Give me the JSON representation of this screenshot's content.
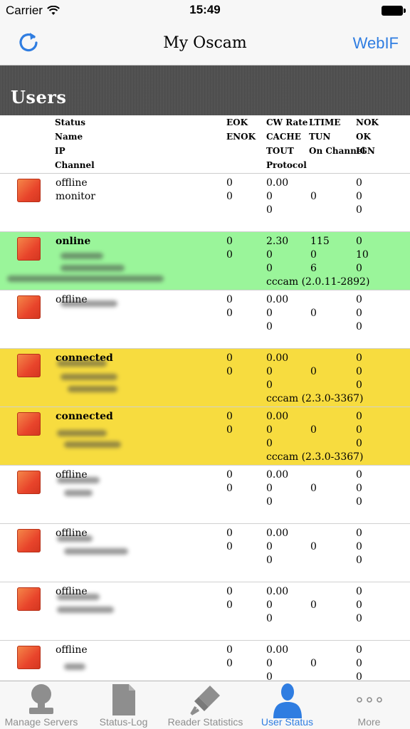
{
  "status_bar": {
    "carrier": "Carrier",
    "time": "15:49"
  },
  "nav": {
    "title": "My Oscam",
    "right_button": "WebIF"
  },
  "section": {
    "title": "Users"
  },
  "headers": {
    "c1": [
      "Status",
      "Name",
      "IP",
      "Channel"
    ],
    "c2": [
      "EOK",
      "ENOK"
    ],
    "c3": [
      "CW Rate",
      "CACHE",
      "TOUT",
      "Protocol"
    ],
    "c4": [
      "LTIME",
      "TUN",
      "On Channel"
    ],
    "c5": [
      "NOK",
      "OK",
      "IGN"
    ]
  },
  "rows": [
    {
      "status": "offline",
      "name": "monitor",
      "bg": "#ffffff",
      "bold": false,
      "eok": "0",
      "enok": "0",
      "cw": "0.00",
      "cache": "0",
      "tout": "0",
      "protocol": "",
      "ltime": "",
      "tun": "0",
      "onch": "",
      "nok": "0",
      "ok": "0",
      "ign": "0"
    },
    {
      "status": "online",
      "name": "",
      "bg": "#9af59a",
      "bold": true,
      "eok": "0",
      "enok": "0",
      "cw": "2.30",
      "cache": "0",
      "tout": "0",
      "protocol": "cccam (2.0.11-2892)",
      "ltime": "115",
      "tun": "0",
      "onch": "6",
      "nok": "0",
      "ok": "10",
      "ign": "0"
    },
    {
      "status": "offline",
      "name": "",
      "bg": "#ffffff",
      "bold": false,
      "eok": "0",
      "enok": "0",
      "cw": "0.00",
      "cache": "0",
      "tout": "0",
      "protocol": "",
      "ltime": "",
      "tun": "0",
      "onch": "",
      "nok": "0",
      "ok": "0",
      "ign": "0"
    },
    {
      "status": "connected",
      "name": "",
      "bg": "#f7dc3f",
      "bold": true,
      "eok": "0",
      "enok": "0",
      "cw": "0.00",
      "cache": "0",
      "tout": "0",
      "protocol": "cccam (2.3.0-3367)",
      "ltime": "",
      "tun": "0",
      "onch": "",
      "nok": "0",
      "ok": "0",
      "ign": "0"
    },
    {
      "status": "connected",
      "name": "",
      "bg": "#f7dc3f",
      "bold": true,
      "eok": "0",
      "enok": "0",
      "cw": "0.00",
      "cache": "0",
      "tout": "0",
      "protocol": "cccam (2.3.0-3367)",
      "ltime": "",
      "tun": "0",
      "onch": "",
      "nok": "0",
      "ok": "0",
      "ign": "0"
    },
    {
      "status": "offline",
      "name": "",
      "bg": "#ffffff",
      "bold": false,
      "eok": "0",
      "enok": "0",
      "cw": "0.00",
      "cache": "0",
      "tout": "0",
      "protocol": "",
      "ltime": "",
      "tun": "0",
      "onch": "",
      "nok": "0",
      "ok": "0",
      "ign": "0"
    },
    {
      "status": "offline",
      "name": "",
      "bg": "#ffffff",
      "bold": false,
      "eok": "0",
      "enok": "0",
      "cw": "0.00",
      "cache": "0",
      "tout": "0",
      "protocol": "",
      "ltime": "",
      "tun": "0",
      "onch": "",
      "nok": "0",
      "ok": "0",
      "ign": "0"
    },
    {
      "status": "offline",
      "name": "",
      "bg": "#ffffff",
      "bold": false,
      "eok": "0",
      "enok": "0",
      "cw": "0.00",
      "cache": "0",
      "tout": "0",
      "protocol": "",
      "ltime": "",
      "tun": "0",
      "onch": "",
      "nok": "0",
      "ok": "0",
      "ign": "0"
    },
    {
      "status": "offline",
      "name": "",
      "bg": "#ffffff",
      "bold": false,
      "eok": "0",
      "enok": "0",
      "cw": "0.00",
      "cache": "0",
      "tout": "0",
      "protocol": "",
      "ltime": "",
      "tun": "0",
      "onch": "",
      "nok": "0",
      "ok": "0",
      "ign": "0"
    }
  ],
  "tabs": [
    {
      "label": "Manage Servers",
      "icon": "person-server-icon",
      "active": false
    },
    {
      "label": "Status-Log",
      "icon": "document-icon",
      "active": false
    },
    {
      "label": "Reader Statistics",
      "icon": "usb-plug-icon",
      "active": false
    },
    {
      "label": "User Status",
      "icon": "user-icon",
      "active": true
    },
    {
      "label": "More",
      "icon": "more-dots-icon",
      "active": false
    }
  ],
  "colors": {
    "accent": "#2f7de1",
    "online": "#9af59a",
    "connected": "#f7dc3f",
    "status_square": "#e8442b"
  }
}
